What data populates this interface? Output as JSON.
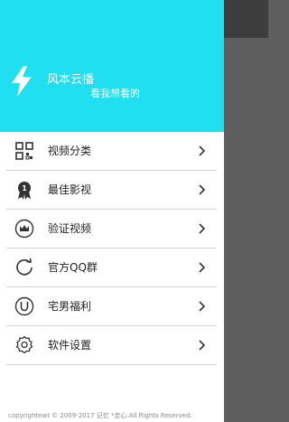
{
  "header": {
    "app_name": "风本云播",
    "tagline": "看我想看的"
  },
  "menu": {
    "items": [
      {
        "label": "视频分类",
        "icon": "grid-icon"
      },
      {
        "label": "最佳影视",
        "icon": "award-badge-icon"
      },
      {
        "label": "验证视频",
        "icon": "crown-icon"
      },
      {
        "label": "官方QQ群",
        "icon": "refresh-icon"
      },
      {
        "label": "宅男福利",
        "icon": "magnet-icon"
      },
      {
        "label": "软件设置",
        "icon": "gear-icon"
      }
    ]
  },
  "footer": {
    "copyright": "copyrightewt © 2009-2017 记忆 *走心.All Rights Reserved."
  },
  "colors": {
    "header_bg": "#1fdff0",
    "overlay": "#5e5e5e",
    "topbar": "#3d3d3d"
  }
}
